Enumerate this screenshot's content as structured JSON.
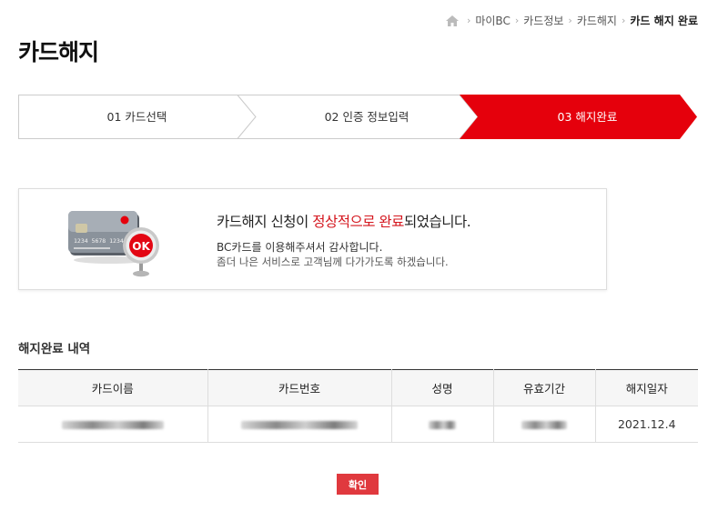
{
  "breadcrumb": {
    "home_icon": "home-icon",
    "items": [
      "마이BC",
      "카드정보",
      "카드해지"
    ],
    "current": "카드 해지 완료"
  },
  "page_title": "카드해지",
  "steps": [
    {
      "label": "01 카드선택",
      "active": false
    },
    {
      "label": "02 인증 정보입력",
      "active": false
    },
    {
      "label": "03 해지완료",
      "active": true
    }
  ],
  "result": {
    "icon": "ok-card-icon",
    "badge": "OK",
    "message_before": "카드해지 신청이 ",
    "message_highlight": "정상적으로 완료",
    "message_after": "되었습니다.",
    "sub1": "BC카드를 이용해주셔서 감사합니다.",
    "sub2": "좀더 나은 서비스로 고객님께 다가가도록 하겠습니다."
  },
  "section_title": "해지완료 내역",
  "table": {
    "headers": [
      "카드이름",
      "카드번호",
      "성명",
      "유효기간",
      "해지일자"
    ],
    "rows": [
      {
        "card_name": "",
        "card_number": "",
        "name": "",
        "expiry": "",
        "cancel_date": "2021.12.4"
      }
    ]
  },
  "confirm_label": "확인",
  "colors": {
    "accent": "#e5000c",
    "highlight": "#d4141c",
    "button": "#e0393e"
  }
}
